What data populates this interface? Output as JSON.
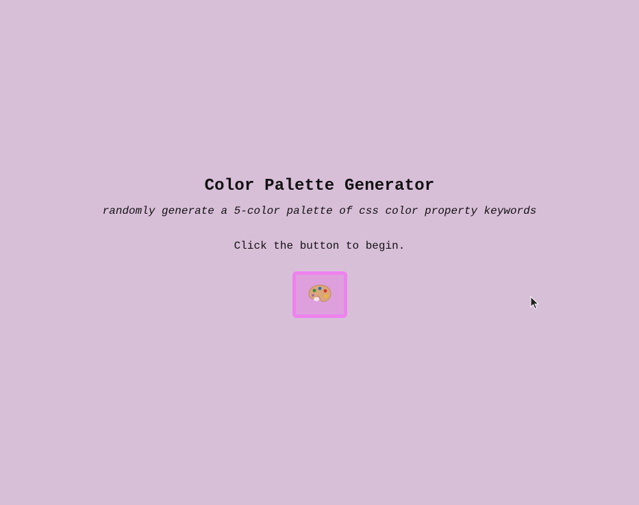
{
  "page": {
    "title": "Color Palette Generator",
    "subtitle": "randomly generate a 5-color palette of css color property keywords",
    "status": "Click the button to begin."
  },
  "generate_button": {
    "icon": "palette-icon"
  },
  "colors": {
    "background": "#d8bfd8",
    "button_fill": "#dda0dd",
    "button_border": "#ee82ee"
  }
}
